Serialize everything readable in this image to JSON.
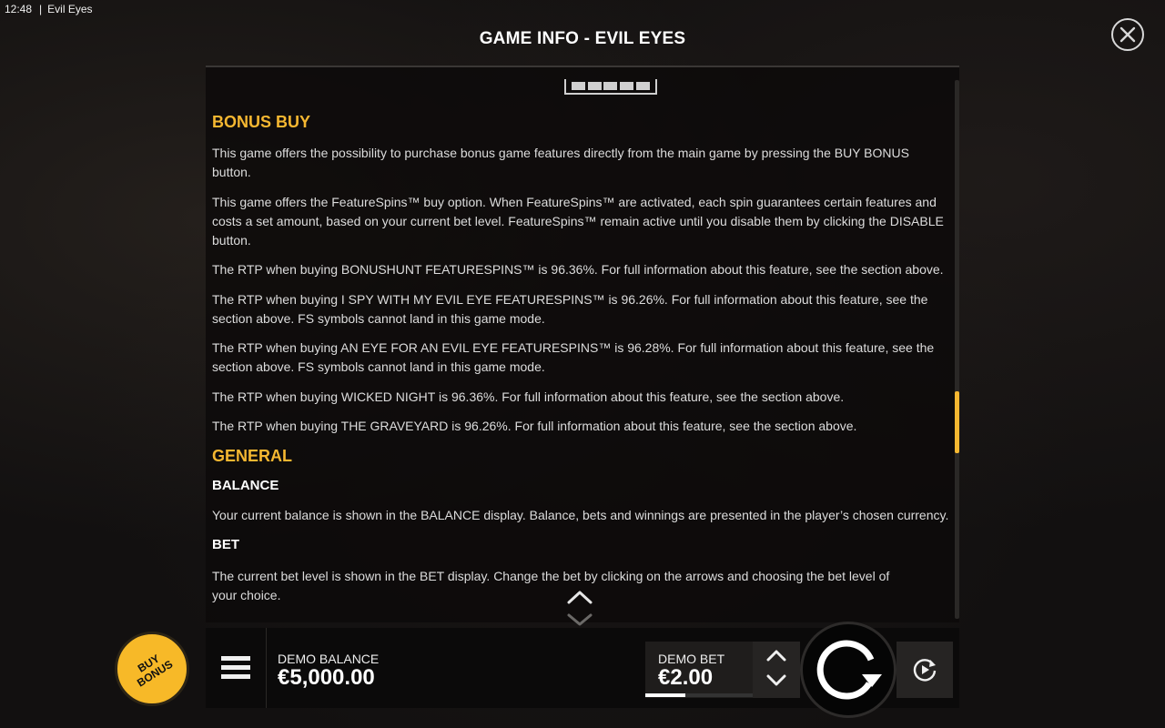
{
  "status_bar": {
    "time": "12:48",
    "app_name": "Evil Eyes"
  },
  "header": {
    "title": "GAME INFO - EVIL EYES"
  },
  "content": {
    "bonus_buy": {
      "heading": "BONUS BUY",
      "paragraphs": [
        "This game offers the possibility to purchase bonus game features directly from the main game by pressing the BUY BONUS button.",
        "This game offers the FeatureSpins™ buy option. When FeatureSpins™ are activated, each spin guarantees certain features and costs a set amount, based on your current bet level. FeatureSpins™ remain active until you disable them by clicking the DISABLE button.",
        "The RTP when buying BONUSHUNT FEATURESPINS™ is 96.36%. For full information about this feature, see the section above.",
        "The RTP when buying I SPY WITH MY EVIL EYE FEATURESPINS™ is 96.26%. For full information about this feature, see the section above. FS symbols cannot land in this game mode.",
        "The RTP when buying AN EYE FOR AN EVIL EYE FEATURESPINS™ is 96.28%. For full information about this feature, see the section above. FS symbols cannot land in this game mode.",
        "The RTP when buying WICKED NIGHT is 96.36%. For full information about this feature, see the section above.",
        "The RTP when buying THE GRAVEYARD is 96.26%. For full information about this feature, see the section above."
      ]
    },
    "general": {
      "heading": "GENERAL",
      "balance": {
        "heading": "BALANCE",
        "text": "Your current balance is shown in the BALANCE display. Balance, bets and winnings are presented in the player’s chosen currency."
      },
      "bet": {
        "heading": "BET",
        "text": "The current bet level is shown in the BET display. Change the bet by clicking on the arrows and choosing the bet level of your choice."
      }
    }
  },
  "bottom_bar": {
    "balance_label": "DEMO BALANCE",
    "balance_value": "€5,000.00",
    "bet_label": "DEMO BET",
    "bet_value": "€2.00",
    "bet_level_fraction": 0.37
  },
  "buy_bonus": {
    "line1": "BUY",
    "line2": "BONUS"
  },
  "colors": {
    "accent": "#f5b731",
    "buy_bonus": "#f7b928"
  },
  "icons": {
    "close": "close-icon",
    "menu": "hamburger-menu-icon",
    "spin": "spin-icon",
    "autoplay": "autoplay-icon"
  }
}
